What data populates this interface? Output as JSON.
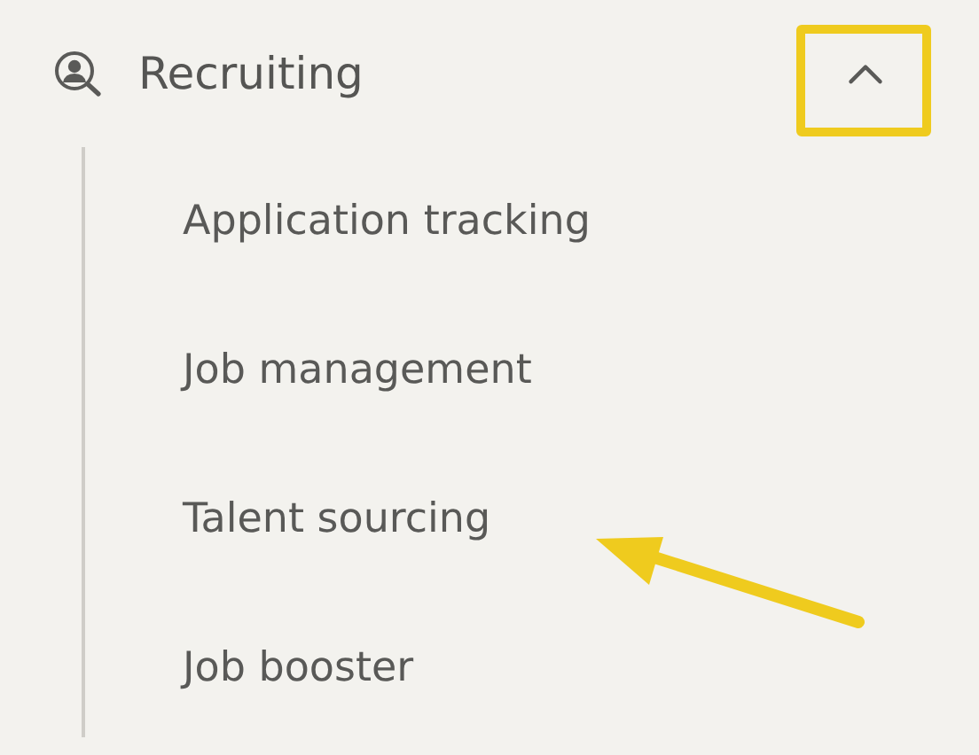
{
  "section": {
    "title": "Recruiting",
    "expanded": true,
    "toggle_highlighted": true
  },
  "items": [
    {
      "label": "Application tracking",
      "arrow_pointed": false
    },
    {
      "label": "Job management",
      "arrow_pointed": false
    },
    {
      "label": "Talent sourcing",
      "arrow_pointed": true
    },
    {
      "label": "Job booster",
      "arrow_pointed": false
    }
  ]
}
